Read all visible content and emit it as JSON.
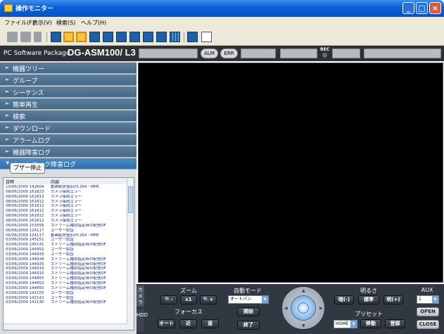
{
  "window": {
    "title": "操作モニター"
  },
  "menu": [
    "ファイル(F)",
    "表示(V)",
    "検索(S)",
    "ヘルプ(H)"
  ],
  "header": {
    "pc_label": "PC Software Package",
    "model": "DG-ASM100/ L3",
    "alm_label": "ALM",
    "err_label": "ERR",
    "rec_label": "REC"
  },
  "sidebar": {
    "items": [
      "機器ツリー",
      "グループ",
      "シーケンス",
      "簡単再生",
      "検索",
      "ダウンロード",
      "アラームログ",
      "機器障害ログ",
      "ネットワーク障害ログ"
    ],
    "buzzer_stop": "ブザー停止",
    "log": {
      "col_date": "日時",
      "col_content": "内容",
      "rows": [
        [
          "10/06/2009 142604",
          "動画配信復旧(H.264・MPE"
        ],
        [
          "08/06/2009 161823",
          "カメラ接続エラー"
        ],
        [
          "08/06/2009 161813",
          "カメラ接続エラー"
        ],
        [
          "08/06/2009 161812",
          "カメラ接続エラー"
        ],
        [
          "08/06/2009 161812",
          "カメラ接続エラー"
        ],
        [
          "08/06/2009 161812",
          "カメラ接続エラー"
        ],
        [
          "08/06/2009 161812",
          "カメラ接続エラー"
        ],
        [
          "08/06/2009 161812",
          "カメラ接続エラー"
        ],
        [
          "06/06/2009 153558",
          "ストリーム種別指定時の配信OF"
        ],
        [
          "06/06/2009 124117",
          "ユーザー認証"
        ],
        [
          "06/06/2009 124117",
          "動画配信復旧(H.264・MPE"
        ],
        [
          "03/06/2009 145151",
          "ユーザー認証"
        ],
        [
          "03/06/2009 145141",
          "ストリーム種別指定時の配信OF"
        ],
        [
          "03/06/2009 144952",
          "ユーザー認証"
        ],
        [
          "03/06/2009 144939",
          "ユーザー認証"
        ],
        [
          "03/06/2009 144938",
          "ストリーム種別指定時の配信OF"
        ],
        [
          "03/06/2009 144935",
          "ストリーム種別指定時の配信OF"
        ],
        [
          "03/06/2009 144919",
          "ストリーム種別指定時の配信OF"
        ],
        [
          "03/06/2009 144915",
          "ストリーム種別指定時の配信OF"
        ],
        [
          "03/06/2009 144855",
          "ストリーム種別指定時の配信OF"
        ],
        [
          "03/06/2009 144853",
          "ストリーム種別指定時の配信OF"
        ],
        [
          "03/06/2009 144850",
          "ストリーム種別指定時の配信OF"
        ],
        [
          "03/06/2009 141155",
          "ユーザー認証"
        ],
        [
          "03/06/2009 141142",
          "ユーザー認証"
        ],
        [
          "03/06/2009 141130",
          "ストリーム種別指定時の配信OF"
        ]
      ]
    }
  },
  "controls": {
    "camera_tab": "カメラ",
    "hdd_tab": "HDD",
    "zoom_title": "ズーム",
    "zoom_out": "🔍-",
    "zoom_x1": "x1",
    "zoom_in": "🔍+",
    "focus_title": "フォーカス",
    "focus_auto": "オート",
    "focus_near": "近",
    "focus_far": "遠",
    "auto_mode_title": "自動モード",
    "auto_mode_value": "オートパン",
    "start": "開始",
    "end": "終了",
    "brightness_title": "明るさ",
    "dark": "暗(-)",
    "normal": "標準",
    "bright": "明(+)",
    "preset_title": "プリセット",
    "preset_value": "HOME",
    "move": "移動",
    "register": "登録",
    "aux_title": "AUX",
    "aux_value": "1",
    "open": "OPEN",
    "close": "CLOSE"
  }
}
